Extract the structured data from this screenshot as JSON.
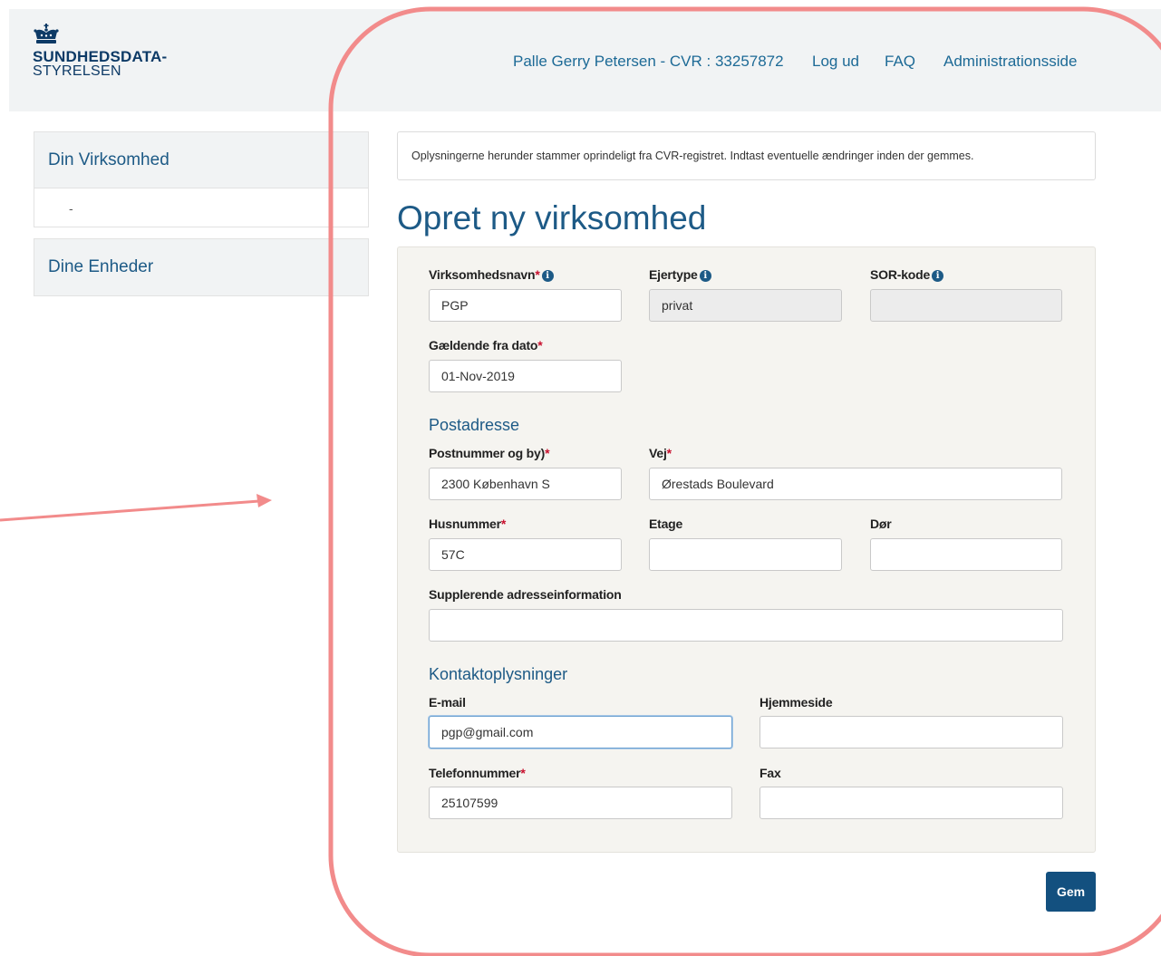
{
  "header": {
    "logo_line1": "SUNDHEDSDATA-",
    "logo_line2": "STYRELSEN",
    "user": "Palle Gerry Petersen - CVR : 33257872",
    "logout": "Log ud",
    "faq": "FAQ",
    "admin": "Administrationsside"
  },
  "sidebar": {
    "company_title": "Din Virksomhed",
    "company_item": "-",
    "units_title": "Dine Enheder"
  },
  "notice": "Oplysningerne herunder stammer oprindeligt fra CVR-registret. Indtast eventuelle ændringer inden der gemmes.",
  "page_title": "Opret ny virksomhed",
  "form": {
    "company_name_label": "Virksomhedsnavn",
    "company_name_value": "PGP",
    "owner_type_label": "Ejertype",
    "owner_type_value": "privat",
    "sor_label": "SOR-kode",
    "sor_value": "",
    "valid_from_label": "Gældende fra dato",
    "valid_from_value": "01-Nov-2019",
    "postal_section": "Postadresse",
    "postcode_label": "Postnummer og by)",
    "postcode_value": "2300 København S",
    "street_label": "Vej",
    "street_value": "Ørestads Boulevard",
    "house_label": "Husnummer",
    "house_value": "57C",
    "floor_label": "Etage",
    "floor_value": "",
    "door_label": "Dør",
    "door_value": "",
    "extra_label": "Supplerende adresseinformation",
    "extra_value": "",
    "contact_section": "Kontaktoplysninger",
    "email_label": "E-mail",
    "email_value": "pgp@gmail.com",
    "website_label": "Hjemmeside",
    "website_value": "",
    "phone_label": "Telefonnummer",
    "phone_value": "25107599",
    "fax_label": "Fax",
    "fax_value": ""
  },
  "save_label": "Gem",
  "icons": {
    "required": "asterisk",
    "info": "info-circle-icon",
    "logo": "crown-icon"
  },
  "colors": {
    "brand": "#0d3a66",
    "link": "#1d6a96",
    "required": "#c8102e",
    "button": "#13507f",
    "annotation": "#f28b8b"
  }
}
